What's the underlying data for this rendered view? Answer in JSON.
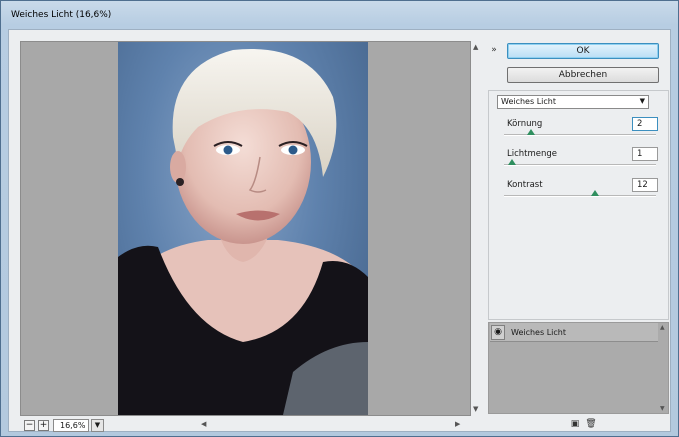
{
  "window": {
    "title": "Weiches Licht (16,6%)"
  },
  "buttons": {
    "ok": "OK",
    "cancel": "Abbrechen"
  },
  "filter": {
    "selected": "Weiches Licht"
  },
  "params": [
    {
      "label": "Körnung",
      "value": "2",
      "slider": 0.18
    },
    {
      "label": "Lichtmenge",
      "value": "1",
      "slider": 0.05
    },
    {
      "label": "Kontrast",
      "value": "12",
      "slider": 0.6
    }
  ],
  "zoom": {
    "value": "16,6%"
  },
  "layer": {
    "name": "Weiches Licht"
  },
  "icons": {
    "collapse": "double-chevron-up-icon",
    "eye": "eye-icon",
    "new_layer": "new-effect-layer-icon",
    "delete": "trash-icon"
  },
  "colors": {
    "accent": "#3c8fbf",
    "slider_thumb": "#2f8f5f",
    "canvas": "#a8a8a8"
  }
}
